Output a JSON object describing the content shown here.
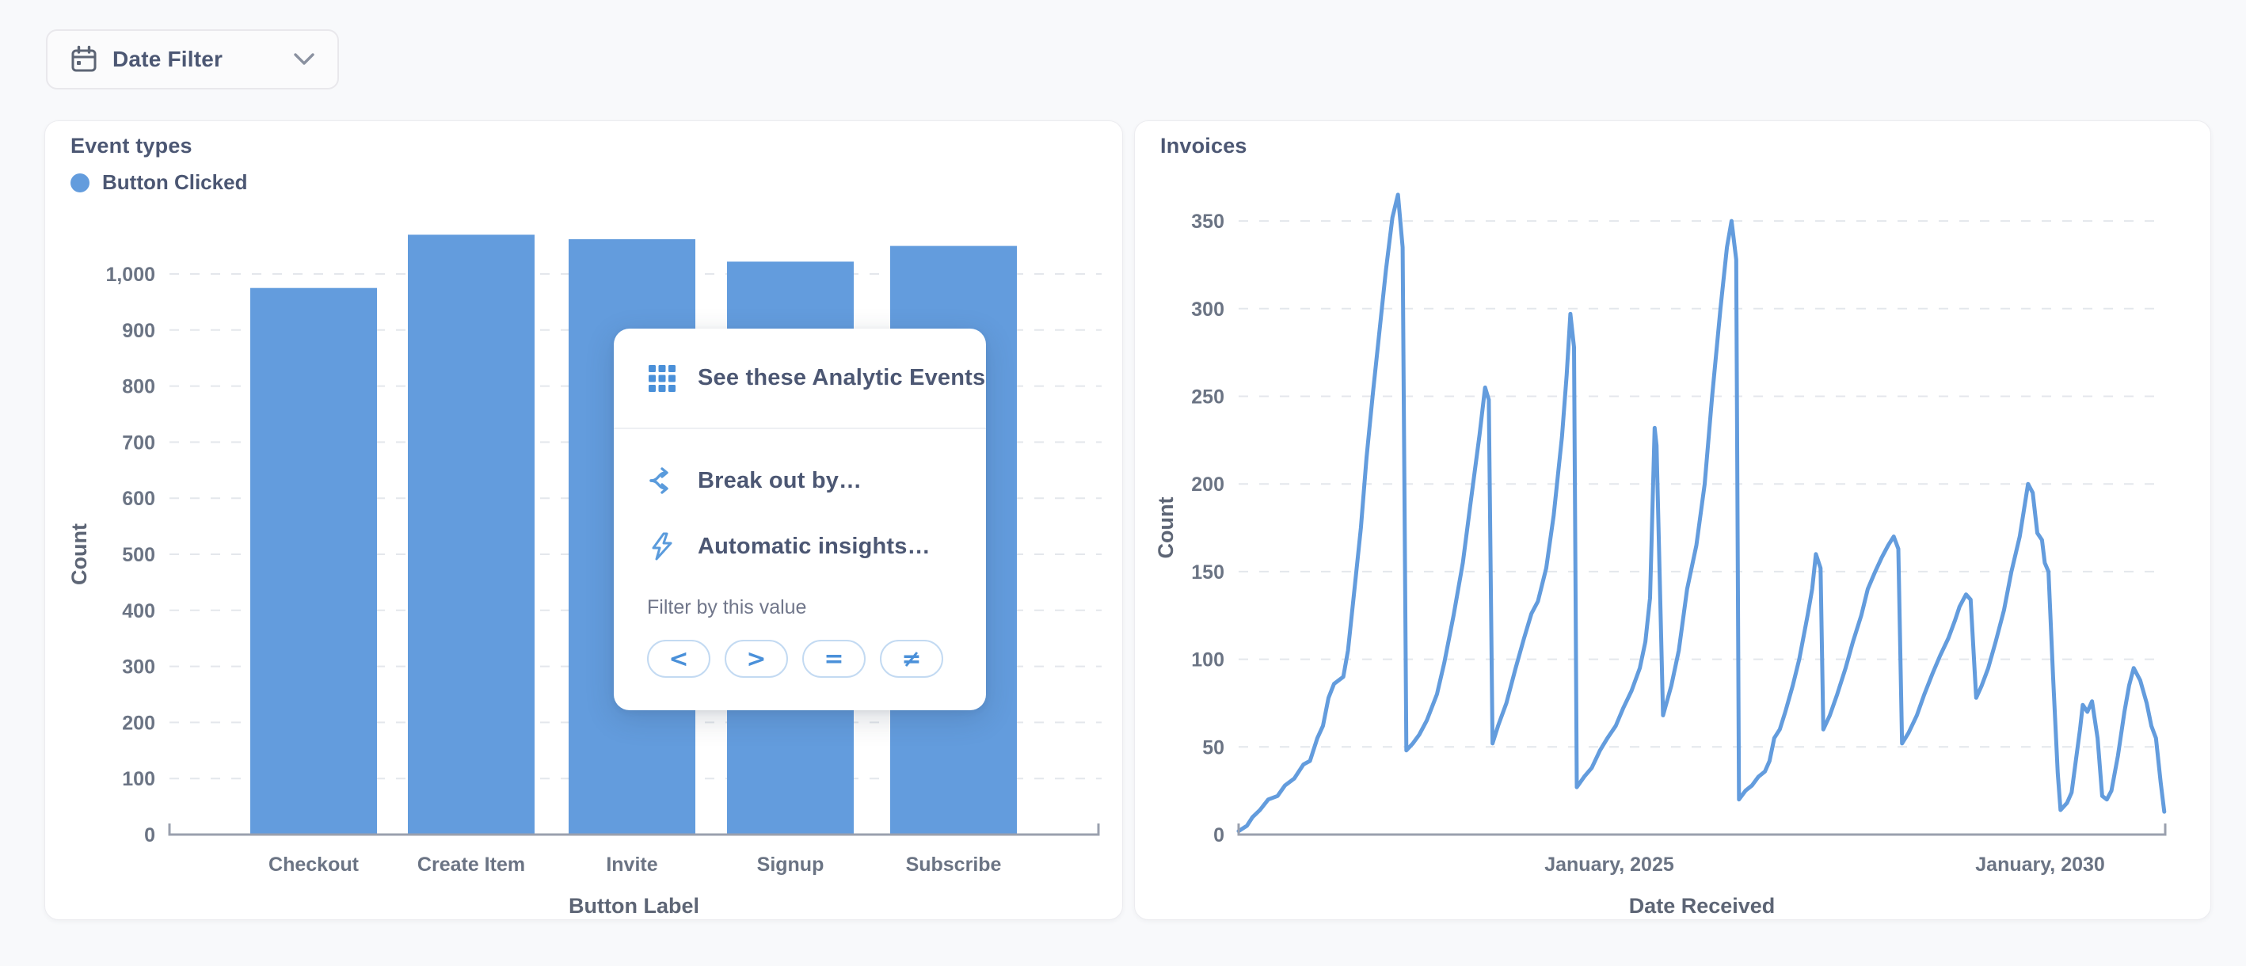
{
  "filter_bar": {
    "date_filter_label": "Date Filter"
  },
  "cards": {
    "events": {
      "title": "Event types",
      "legend_label": "Button Clicked",
      "legend_color": "#639CDD"
    },
    "invoices": {
      "title": "Invoices"
    }
  },
  "context_menu": {
    "items": [
      {
        "label": "See these Analytic Events",
        "icon": "grid-icon"
      },
      {
        "label": "Break out by…",
        "icon": "breakout-icon"
      },
      {
        "label": "Automatic insights…",
        "icon": "insights-bolt-icon"
      }
    ],
    "filter_label": "Filter by this value",
    "operators": [
      "<",
      ">",
      "=",
      "≠"
    ]
  },
  "colors": {
    "accent_blue": "#639CDD",
    "icon_blue": "#4A90D9",
    "page_bg": "#F8F9FB",
    "card_bg": "#FFFFFF",
    "text_dark": "#4C5773",
    "tick_gray": "#6B7484",
    "grid_gray": "#E4E7EC",
    "axis_gray": "#9AA0AE"
  },
  "chart_data": [
    {
      "type": "bar",
      "title": "Event types",
      "series_name": "Button Clicked",
      "categories": [
        "Checkout",
        "Create Item",
        "Invite",
        "Signup",
        "Subscribe"
      ],
      "values": [
        975,
        1070,
        1062,
        1022,
        1050
      ],
      "xlabel": "Button Label",
      "ylabel": "Count",
      "y_ticks": [
        0,
        100,
        200,
        300,
        400,
        500,
        600,
        700,
        800,
        900,
        1000
      ],
      "ylim": [
        0,
        1100
      ],
      "bar_color": "#639CDD",
      "grid": "horizontal-dashed",
      "legend_position": "top-left"
    },
    {
      "type": "line",
      "title": "Invoices",
      "xlabel": "Date Received",
      "ylabel": "Count",
      "y_ticks": [
        0,
        50,
        100,
        150,
        200,
        250,
        300,
        350
      ],
      "ylim": [
        0,
        385
      ],
      "x_ticks": [
        {
          "label": "January, 2025",
          "pos": 0.4
        },
        {
          "label": "January, 2030",
          "pos": 0.865
        }
      ],
      "line_color": "#639CDD",
      "grid": "horizontal-dashed",
      "points": [
        [
          0.0,
          2
        ],
        [
          0.009,
          5
        ],
        [
          0.015,
          10
        ],
        [
          0.023,
          14
        ],
        [
          0.032,
          20
        ],
        [
          0.042,
          22
        ],
        [
          0.05,
          28
        ],
        [
          0.06,
          32
        ],
        [
          0.07,
          40
        ],
        [
          0.077,
          42
        ],
        [
          0.085,
          55
        ],
        [
          0.091,
          62
        ],
        [
          0.097,
          78
        ],
        [
          0.103,
          86
        ],
        [
          0.113,
          90
        ],
        [
          0.118,
          105
        ],
        [
          0.125,
          140
        ],
        [
          0.132,
          175
        ],
        [
          0.138,
          215
        ],
        [
          0.145,
          252
        ],
        [
          0.152,
          287
        ],
        [
          0.159,
          322
        ],
        [
          0.166,
          352
        ],
        [
          0.172,
          365
        ],
        [
          0.177,
          335
        ],
        [
          0.181,
          48
        ],
        [
          0.188,
          52
        ],
        [
          0.195,
          57
        ],
        [
          0.203,
          65
        ],
        [
          0.214,
          80
        ],
        [
          0.222,
          98
        ],
        [
          0.232,
          125
        ],
        [
          0.242,
          155
        ],
        [
          0.251,
          192
        ],
        [
          0.26,
          228
        ],
        [
          0.266,
          255
        ],
        [
          0.27,
          248
        ],
        [
          0.274,
          52
        ],
        [
          0.28,
          62
        ],
        [
          0.289,
          75
        ],
        [
          0.299,
          95
        ],
        [
          0.308,
          112
        ],
        [
          0.316,
          126
        ],
        [
          0.323,
          133
        ],
        [
          0.332,
          152
        ],
        [
          0.34,
          182
        ],
        [
          0.349,
          227
        ],
        [
          0.354,
          262
        ],
        [
          0.358,
          297
        ],
        [
          0.362,
          278
        ],
        [
          0.365,
          27
        ],
        [
          0.373,
          33
        ],
        [
          0.381,
          38
        ],
        [
          0.39,
          48
        ],
        [
          0.398,
          55
        ],
        [
          0.407,
          62
        ],
        [
          0.415,
          72
        ],
        [
          0.424,
          82
        ],
        [
          0.433,
          95
        ],
        [
          0.439,
          110
        ],
        [
          0.444,
          135
        ],
        [
          0.449,
          232
        ],
        [
          0.451,
          222
        ],
        [
          0.458,
          68
        ],
        [
          0.467,
          85
        ],
        [
          0.475,
          105
        ],
        [
          0.484,
          140
        ],
        [
          0.494,
          165
        ],
        [
          0.503,
          200
        ],
        [
          0.511,
          250
        ],
        [
          0.52,
          300
        ],
        [
          0.527,
          335
        ],
        [
          0.532,
          350
        ],
        [
          0.537,
          328
        ],
        [
          0.54,
          20
        ],
        [
          0.547,
          25
        ],
        [
          0.554,
          28
        ],
        [
          0.561,
          33
        ],
        [
          0.568,
          36
        ],
        [
          0.573,
          42
        ],
        [
          0.578,
          55
        ],
        [
          0.584,
          60
        ],
        [
          0.59,
          70
        ],
        [
          0.598,
          85
        ],
        [
          0.605,
          100
        ],
        [
          0.614,
          125
        ],
        [
          0.619,
          140
        ],
        [
          0.623,
          160
        ],
        [
          0.628,
          152
        ],
        [
          0.631,
          60
        ],
        [
          0.638,
          68
        ],
        [
          0.646,
          80
        ],
        [
          0.655,
          95
        ],
        [
          0.663,
          110
        ],
        [
          0.672,
          125
        ],
        [
          0.679,
          140
        ],
        [
          0.687,
          150
        ],
        [
          0.694,
          158
        ],
        [
          0.701,
          165
        ],
        [
          0.707,
          170
        ],
        [
          0.712,
          163
        ],
        [
          0.716,
          52
        ],
        [
          0.723,
          58
        ],
        [
          0.732,
          68
        ],
        [
          0.74,
          80
        ],
        [
          0.749,
          92
        ],
        [
          0.757,
          102
        ],
        [
          0.766,
          112
        ],
        [
          0.773,
          122
        ],
        [
          0.778,
          130
        ],
        [
          0.785,
          137
        ],
        [
          0.79,
          134
        ],
        [
          0.796,
          78
        ],
        [
          0.802,
          85
        ],
        [
          0.809,
          95
        ],
        [
          0.817,
          110
        ],
        [
          0.826,
          128
        ],
        [
          0.834,
          150
        ],
        [
          0.843,
          170
        ],
        [
          0.849,
          190
        ],
        [
          0.852,
          200
        ],
        [
          0.857,
          195
        ],
        [
          0.862,
          172
        ],
        [
          0.867,
          168
        ],
        [
          0.87,
          155
        ],
        [
          0.874,
          150
        ],
        [
          0.879,
          90
        ],
        [
          0.884,
          35
        ],
        [
          0.887,
          14
        ],
        [
          0.894,
          18
        ],
        [
          0.899,
          24
        ],
        [
          0.903,
          40
        ],
        [
          0.908,
          60
        ],
        [
          0.911,
          74
        ],
        [
          0.916,
          70
        ],
        [
          0.921,
          76
        ],
        [
          0.927,
          55
        ],
        [
          0.932,
          22
        ],
        [
          0.937,
          20
        ],
        [
          0.942,
          25
        ],
        [
          0.949,
          45
        ],
        [
          0.956,
          70
        ],
        [
          0.961,
          85
        ],
        [
          0.966,
          95
        ],
        [
          0.973,
          88
        ],
        [
          0.98,
          75
        ],
        [
          0.985,
          62
        ],
        [
          0.99,
          55
        ],
        [
          0.995,
          30
        ],
        [
          0.999,
          13
        ]
      ]
    }
  ]
}
